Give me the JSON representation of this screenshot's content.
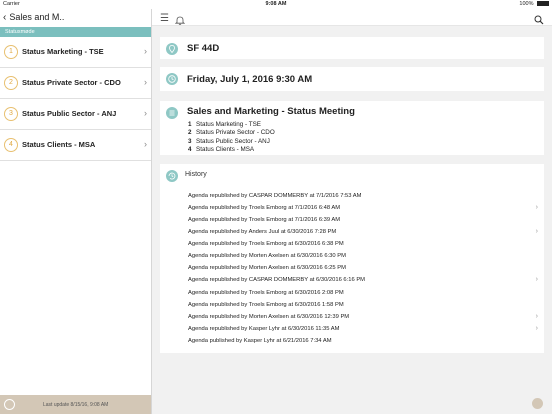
{
  "status_bar": {
    "carrier": "Carrier",
    "time": "9:08 AM",
    "battery": "100%"
  },
  "left": {
    "back_label": "Sales and M..",
    "section": "Statusmøde",
    "items": [
      {
        "num": "1",
        "label": "Status Marketing - TSE"
      },
      {
        "num": "2",
        "label": "Status Private Sector - CDO"
      },
      {
        "num": "3",
        "label": "Status Public Sector - ANJ"
      },
      {
        "num": "4",
        "label": "Status Clients - MSA"
      }
    ],
    "footer": "Last update 8/15/16, 9:08 AM"
  },
  "main": {
    "room": "SF 44D",
    "date": "Friday, July 1, 2016 9:30 AM",
    "meeting_title": "Sales and Marketing - Status Meeting",
    "agenda": [
      {
        "n": "1",
        "text": "Status Marketing - TSE"
      },
      {
        "n": "2",
        "text": "Status Private Sector - CDO"
      },
      {
        "n": "3",
        "text": "Status Public Sector - ANJ"
      },
      {
        "n": "4",
        "text": "Status Clients - MSA"
      }
    ],
    "history_title": "History",
    "history": [
      {
        "text": "Agenda republished by CASPAR DOMMERBY at 7/1/2016 7:53 AM",
        "arrow": false
      },
      {
        "text": "Agenda republished by Troels Emborg at 7/1/2016 6:48 AM",
        "arrow": true
      },
      {
        "text": "Agenda republished by Troels Emborg at 7/1/2016 6:39 AM",
        "arrow": false
      },
      {
        "text": "Agenda republished by Anders Juul at 6/30/2016 7:28 PM",
        "arrow": true
      },
      {
        "text": "Agenda republished by Troels Emborg at 6/30/2016 6:38 PM",
        "arrow": false
      },
      {
        "text": "Agenda republished by Morten Axelsen at 6/30/2016 6:30 PM",
        "arrow": false
      },
      {
        "text": "Agenda republished by Morten Axelsen at 6/30/2016 6:25 PM",
        "arrow": false
      },
      {
        "text": "Agenda republished by CASPAR DOMMERBY at 6/30/2016 6:16 PM",
        "arrow": true
      },
      {
        "text": "Agenda republished by Troels Emborg at 6/30/2016 2:08 PM",
        "arrow": false
      },
      {
        "text": "Agenda republished by Troels Emborg at 6/30/2016 1:58 PM",
        "arrow": false
      },
      {
        "text": "Agenda republished by Morten Axelsen at 6/30/2016 12:39 PM",
        "arrow": true
      },
      {
        "text": "Agenda republished by Kasper Lyhr at 6/30/2016 11:35 AM",
        "arrow": true
      },
      {
        "text": "Agenda published by Kasper Lyhr at 6/21/2016 7:34 AM",
        "arrow": false
      }
    ]
  },
  "colors": {
    "accent": "#7bbfbe",
    "number_ring": "#e0a840",
    "footer_bg": "#d3c7b6"
  },
  "icons": [
    "back-chevron-icon",
    "menu-icon",
    "bell-icon",
    "search-icon",
    "location-icon",
    "clock-icon",
    "list-icon",
    "history-icon",
    "info-icon",
    "help-icon"
  ]
}
